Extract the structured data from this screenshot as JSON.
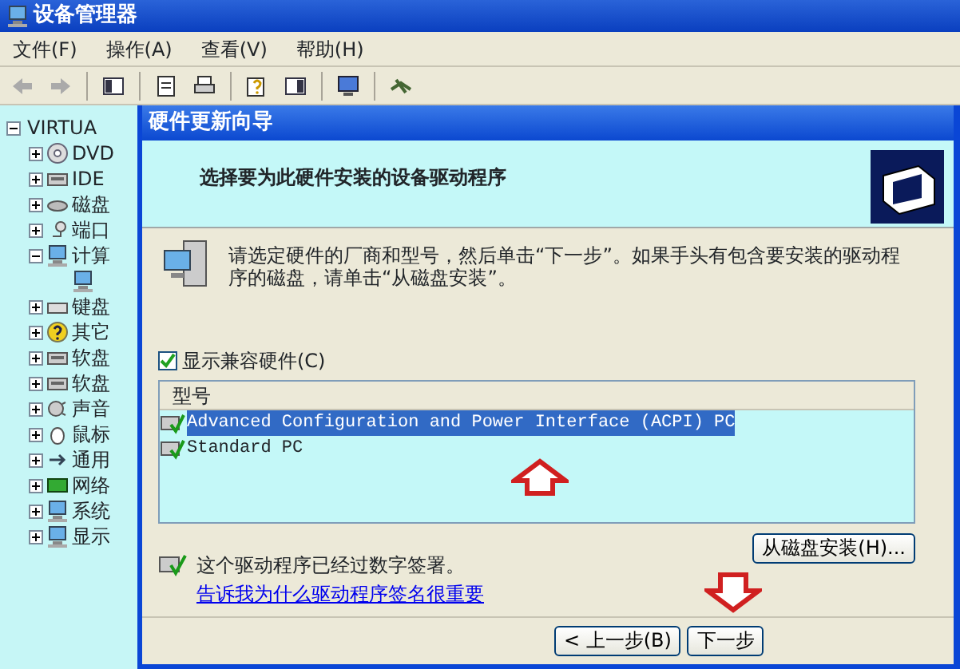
{
  "window": {
    "title": "设备管理器"
  },
  "menu": [
    "文件(F)",
    "操作(A)",
    "查看(V)",
    "帮助(H)"
  ],
  "tree": [
    {
      "label": "VIRTUA",
      "expanded": true,
      "children": [
        {
          "label": "DVD",
          "expanded": false,
          "kind": "dvd"
        },
        {
          "label": "IDE",
          "expanded": false,
          "kind": "drive"
        },
        {
          "label": "磁盘",
          "expanded": false,
          "kind": "disk"
        },
        {
          "label": "端口",
          "expanded": false,
          "kind": "port"
        },
        {
          "label": "计算",
          "expanded": true,
          "kind": "computer",
          "children": [
            {
              "kind": "computer"
            }
          ]
        },
        {
          "label": "键盘",
          "expanded": false,
          "kind": "keyboard"
        },
        {
          "label": "其它",
          "expanded": false,
          "kind": "unknown"
        },
        {
          "label": "软盘",
          "expanded": false,
          "kind": "drive"
        },
        {
          "label": "软盘",
          "expanded": false,
          "kind": "drive"
        },
        {
          "label": "声音",
          "expanded": false,
          "kind": "sound"
        },
        {
          "label": "鼠标",
          "expanded": false,
          "kind": "mouse"
        },
        {
          "label": "通用",
          "expanded": false,
          "kind": "usb"
        },
        {
          "label": "网络",
          "expanded": false,
          "kind": "network"
        },
        {
          "label": "系统",
          "expanded": false,
          "kind": "computer"
        },
        {
          "label": "显示",
          "expanded": false,
          "kind": "computer"
        }
      ]
    }
  ],
  "dialog": {
    "title": "硬件更新向导",
    "heading": "选择要为此硬件安装的设备驱动程序",
    "intro": "请选定硬件的厂商和型号，然后单击“下一步”。如果手头有包含要安装的驱动程序的磁盘，请单击“从磁盘安装”。",
    "show_compatible": {
      "label": "显示兼容硬件(C)",
      "checked": true
    },
    "list": {
      "column": "型号",
      "rows": [
        {
          "label": "Advanced Configuration and Power Interface (ACPI) PC",
          "selected": true
        },
        {
          "label": "Standard PC",
          "selected": false
        }
      ]
    },
    "have_disk": "从磁盘安装(H)...",
    "signed": "这个驱动程序已经过数字签署。",
    "signing_link": "告诉我为什么驱动程序签名很重要",
    "buttons": [
      "< 上一步(B)",
      "下一步"
    ]
  }
}
